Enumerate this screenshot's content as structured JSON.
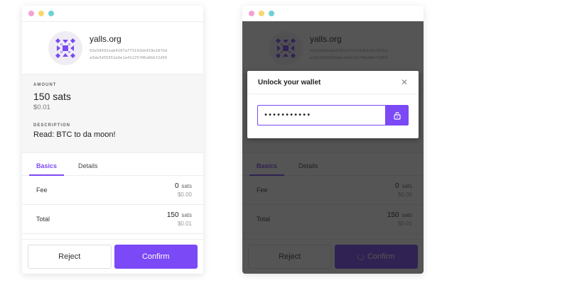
{
  "colors": {
    "accent": "#7b49f5",
    "overlay": "#141414",
    "dot_pink": "#f3a1d6",
    "dot_yellow": "#f7d86d",
    "dot_teal": "#6fd0d6"
  },
  "site": {
    "name": "yalls.org",
    "pubkey_line1": "03e58492eab4187a773141bb419e187bd",
    "pubkey_line2": "a3de3d55652e6e1a41225f06a0bbf2d56"
  },
  "payment": {
    "amount_label": "AMOUNT",
    "amount": "150 sats",
    "fiat": "$0.01",
    "description_label": "DESCRIPTION",
    "description": "Read: BTC to da moon!"
  },
  "tabs": [
    {
      "label": "Basics",
      "active": true
    },
    {
      "label": "Details",
      "active": false
    }
  ],
  "rows": [
    {
      "label": "Fee",
      "value": "0",
      "unit": "sats",
      "fiat": "$0.00"
    },
    {
      "label": "Total",
      "value": "150",
      "unit": "sats",
      "fiat": "$0.01"
    }
  ],
  "buttons": {
    "reject": "Reject",
    "confirm": "Confirm"
  },
  "modal": {
    "title": "Unlock your wallet",
    "close_icon": "close-icon",
    "password_value": "•••••••••••",
    "unlock_icon": "unlock-icon"
  }
}
